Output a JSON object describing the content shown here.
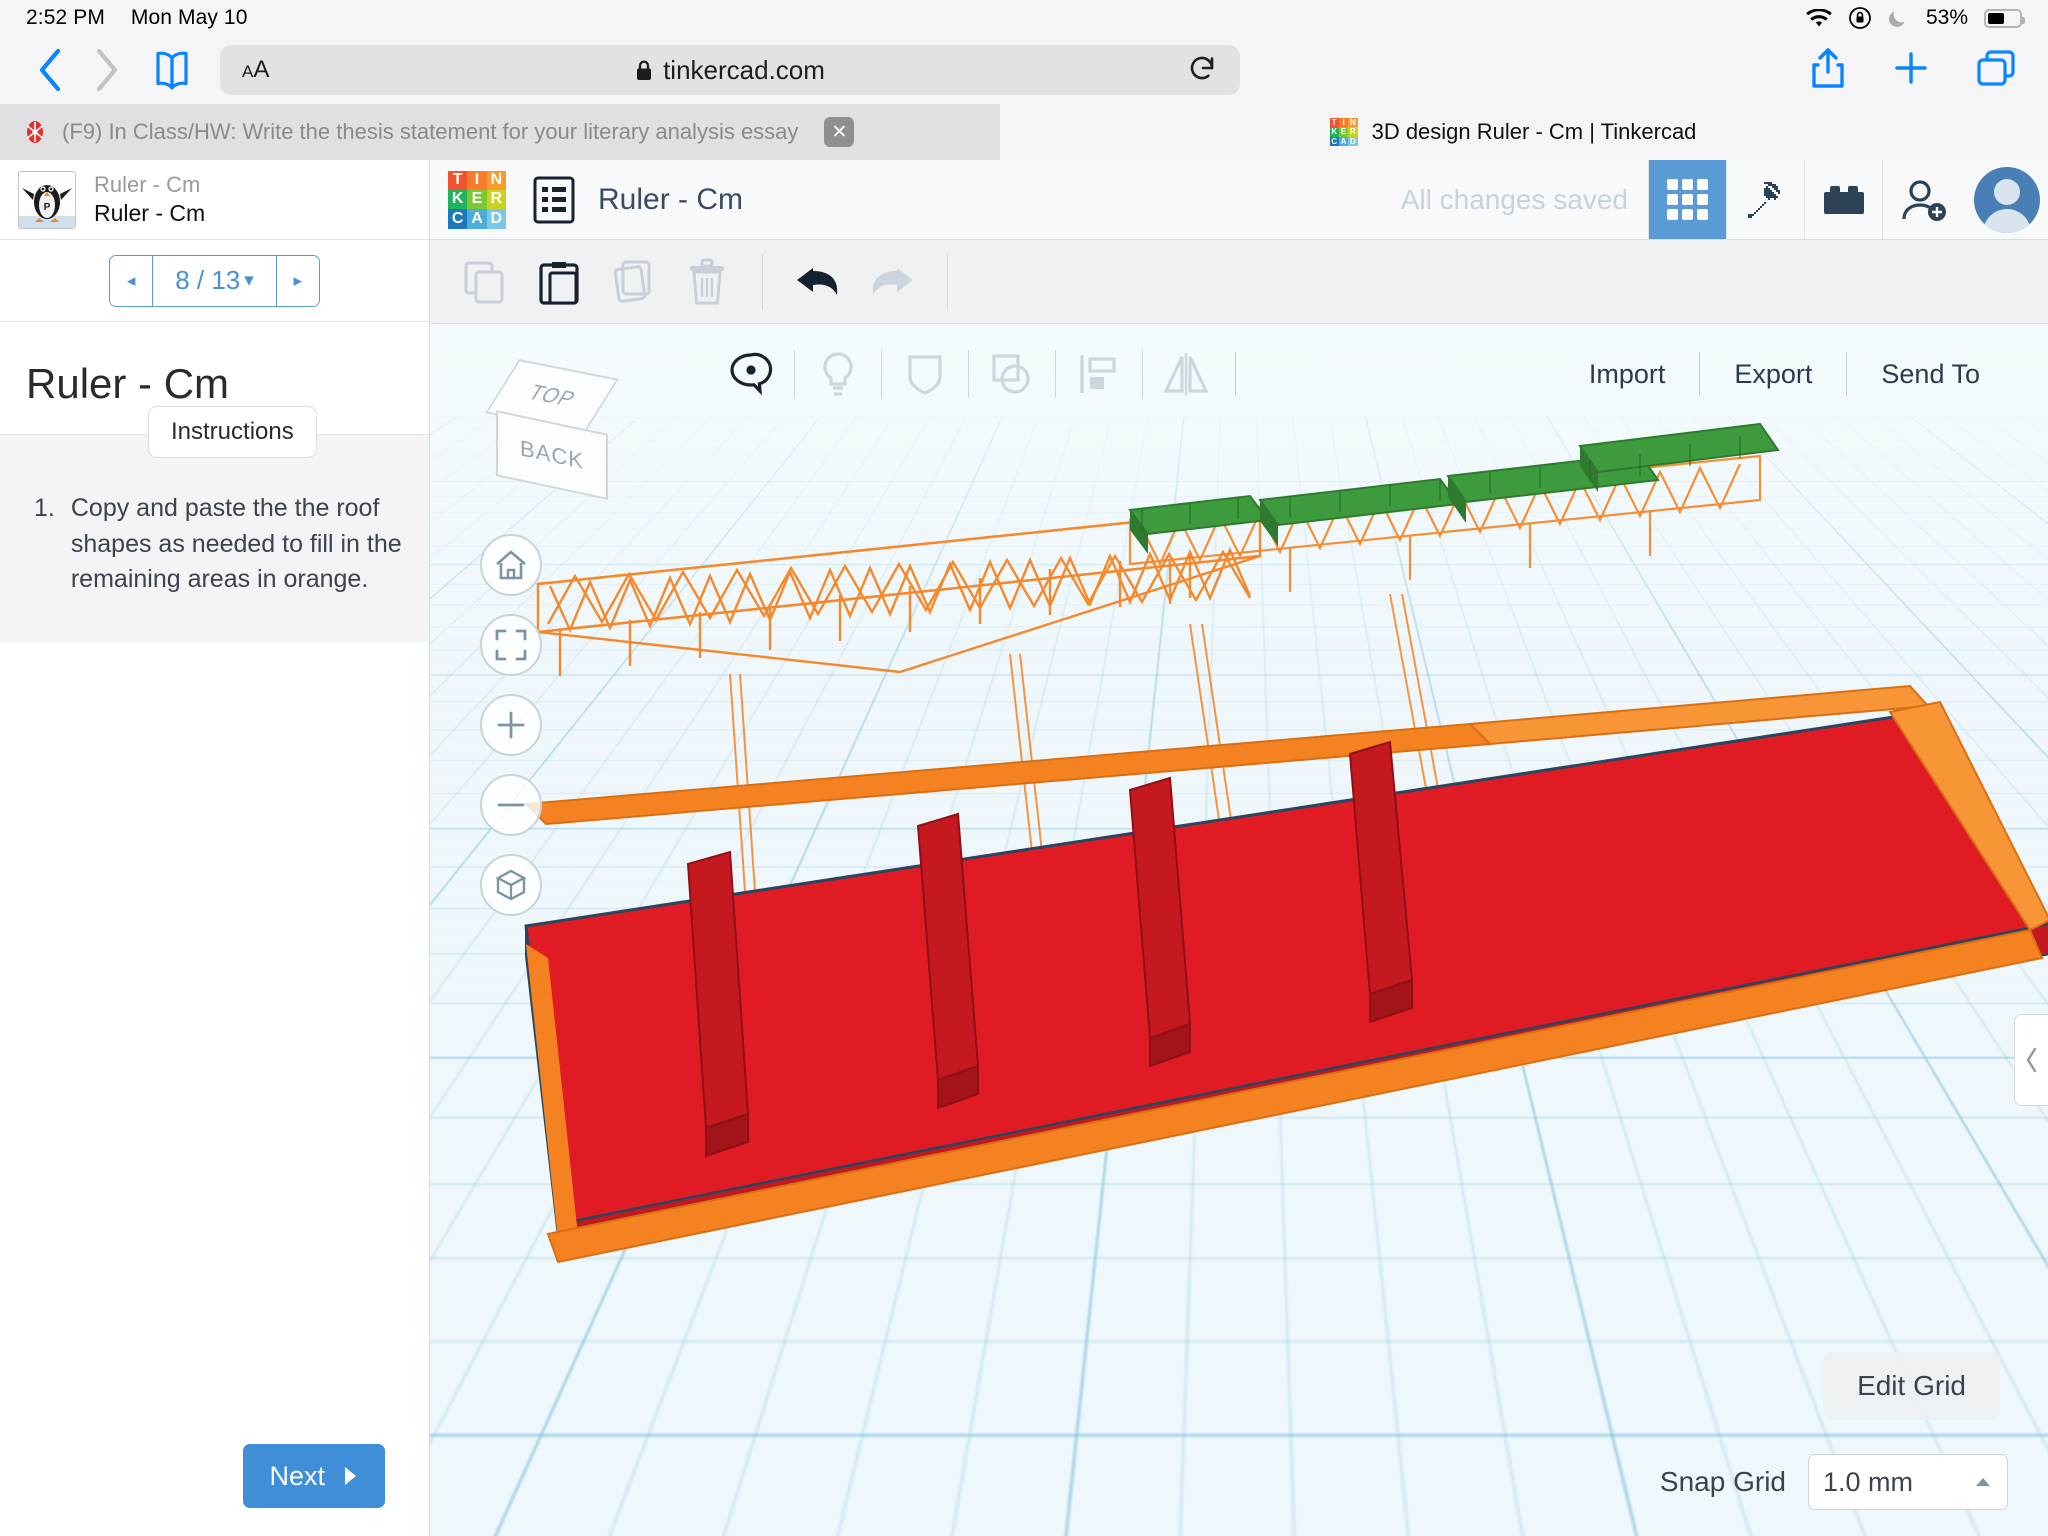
{
  "status_bar": {
    "time": "2:52 PM",
    "date": "Mon May 10",
    "battery_percent": "53%",
    "icons": [
      "wifi-icon",
      "rotation-lock-icon",
      "do-not-disturb-moon-icon",
      "battery-icon"
    ]
  },
  "browser": {
    "back_icon": "chevron-left-icon",
    "forward_icon": "chevron-right-icon",
    "bookmarks_icon": "book-icon",
    "text_size_small": "A",
    "text_size_large": "A",
    "lock_icon": "lock-icon",
    "url": "tinkercad.com",
    "reload_icon": "reload-icon",
    "share_icon": "share-icon",
    "new_tab_icon": "plus-icon",
    "tabs_icon": "tab-overview-icon",
    "tabs": [
      {
        "title": "(F9) In Class/HW: Write the thesis statement for your literary analysis essay",
        "active": false,
        "favicon": "red-starburst-icon",
        "close_label": "✕"
      },
      {
        "title": "3D design Ruler - Cm | Tinkercad",
        "active": true,
        "favicon": "tinkercad-icon"
      }
    ]
  },
  "sidebar": {
    "avatar": "penguin-avatar",
    "class_name": "Ruler - Cm",
    "lesson_name": "Ruler - Cm",
    "pager": {
      "prev": "◂",
      "value": "8 / 13",
      "caret": "▾",
      "next": "▸"
    },
    "title": "Ruler - Cm",
    "instructions_tab": "Instructions",
    "steps": [
      {
        "number": "1.",
        "text": "Copy and paste the the roof shapes as needed to fill in the remaining areas in orange."
      }
    ],
    "next_label": "Next",
    "next_icon": "chevron-right-icon"
  },
  "editor": {
    "logo": {
      "name": "tinkercad-logo",
      "cells": [
        {
          "letter": "T",
          "color": "#f4512c"
        },
        {
          "letter": "I",
          "color": "#f97c2c"
        },
        {
          "letter": "N",
          "color": "#f99c2c"
        },
        {
          "letter": "K",
          "color": "#1fb45c"
        },
        {
          "letter": "E",
          "color": "#7dc832"
        },
        {
          "letter": "R",
          "color": "#c8d320"
        },
        {
          "letter": "C",
          "color": "#1b78bd"
        },
        {
          "letter": "A",
          "color": "#4aaed9"
        },
        {
          "letter": "D",
          "color": "#7cc7e8"
        }
      ]
    },
    "panel_toggle_icon": "list-panel-icon",
    "document_name": "Ruler - Cm",
    "save_status": "All changes saved",
    "header_buttons": [
      {
        "name": "blocks-grid-button",
        "icon": "grid-9-icon",
        "active": true
      },
      {
        "name": "minecraft-button",
        "icon": "pickaxe-icon",
        "active": false
      },
      {
        "name": "lego-button",
        "icon": "lego-brick-icon",
        "active": false
      },
      {
        "name": "invite-button",
        "icon": "person-add-icon",
        "active": false
      }
    ],
    "avatar": "user-avatar",
    "toolbar": [
      {
        "name": "copy-button",
        "icon": "copy-icon",
        "enabled": false
      },
      {
        "name": "paste-button",
        "icon": "paste-icon",
        "enabled": true
      },
      {
        "name": "duplicate-button",
        "icon": "duplicate-icon",
        "enabled": false
      },
      {
        "name": "delete-button",
        "icon": "trash-icon",
        "enabled": false
      },
      {
        "name": "undo-button",
        "icon": "undo-arrow-icon",
        "enabled": true
      },
      {
        "name": "redo-button",
        "icon": "redo-arrow-icon",
        "enabled": false
      }
    ],
    "viewport_tools": [
      {
        "name": "comment-tool",
        "icon": "speech-bubble-icon",
        "active": true
      },
      {
        "name": "light-tool",
        "icon": "lightbulb-icon",
        "active": false
      },
      {
        "name": "shield-tool",
        "icon": "shield-icon",
        "active": false
      },
      {
        "name": "shape-tool",
        "icon": "square-circle-icon",
        "active": false
      },
      {
        "name": "align-tool",
        "icon": "align-icon",
        "active": false
      },
      {
        "name": "mirror-tool",
        "icon": "mirror-icon",
        "active": false
      }
    ],
    "viewport_links": [
      "Import",
      "Export",
      "Send To"
    ],
    "view_cube": {
      "top_label": "TOP",
      "front_label": "BACK"
    },
    "view_controls": [
      {
        "name": "home-view-button",
        "icon": "home-icon"
      },
      {
        "name": "fit-all-button",
        "icon": "fit-frame-icon"
      },
      {
        "name": "zoom-in-button",
        "icon": "plus-icon"
      },
      {
        "name": "zoom-out-button",
        "icon": "minus-icon"
      },
      {
        "name": "ortho-perspective-button",
        "icon": "cube-icon"
      }
    ],
    "edit_grid_label": "Edit Grid",
    "snap_grid_label": "Snap Grid",
    "snap_grid_value": "1.0 mm",
    "scene": {
      "description": "3D design workplane with a large red sloped roof panel on orange beams, orange wireframe truss assemblies and green roof panels above",
      "colors": {
        "red": "#e01b24",
        "orange": "#f58220",
        "green": "#3c9a3c",
        "workplane": "#e8f5fa"
      }
    }
  }
}
